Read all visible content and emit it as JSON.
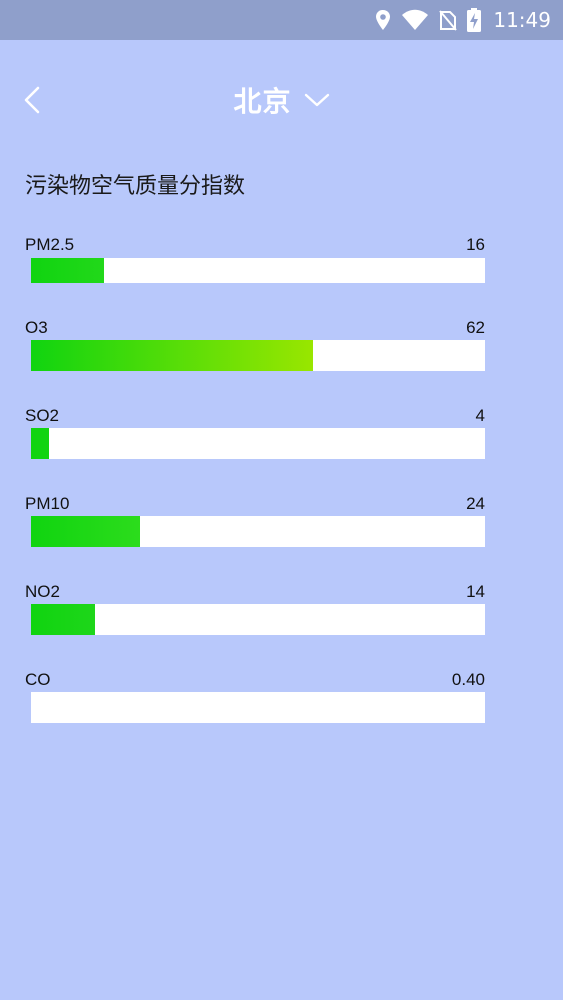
{
  "status_bar": {
    "time": "11:49",
    "icons": [
      "location-icon",
      "wifi-icon",
      "no-sim-icon",
      "battery-charging-icon"
    ]
  },
  "header": {
    "back_icon": "chevron-left-icon",
    "city": "北京",
    "dropdown_icon": "chevron-down-icon"
  },
  "section": {
    "title": "污染物空气质量分指数"
  },
  "pollutants": [
    {
      "name": "PM2.5",
      "value": "16",
      "fill_fraction": 0.161,
      "color_end": "#22d81a"
    },
    {
      "name": "O3",
      "value": "62",
      "fill_fraction": 0.621,
      "color_end": "#99e600"
    },
    {
      "name": "SO2",
      "value": "4",
      "fill_fraction": 0.04,
      "color_end": "#12d412"
    },
    {
      "name": "PM10",
      "value": "24",
      "fill_fraction": 0.24,
      "color_end": "#2cdc1c"
    },
    {
      "name": "NO2",
      "value": "14",
      "fill_fraction": 0.141,
      "color_end": "#1ed61a"
    },
    {
      "name": "CO",
      "value": "0.40",
      "fill_fraction": 0.0,
      "color_end": "#10d410"
    }
  ],
  "colors": {
    "background": "#b8c8fb",
    "status_bar": "#8f9fcb",
    "bar_start": "#10d410",
    "track": "#ffffff"
  }
}
